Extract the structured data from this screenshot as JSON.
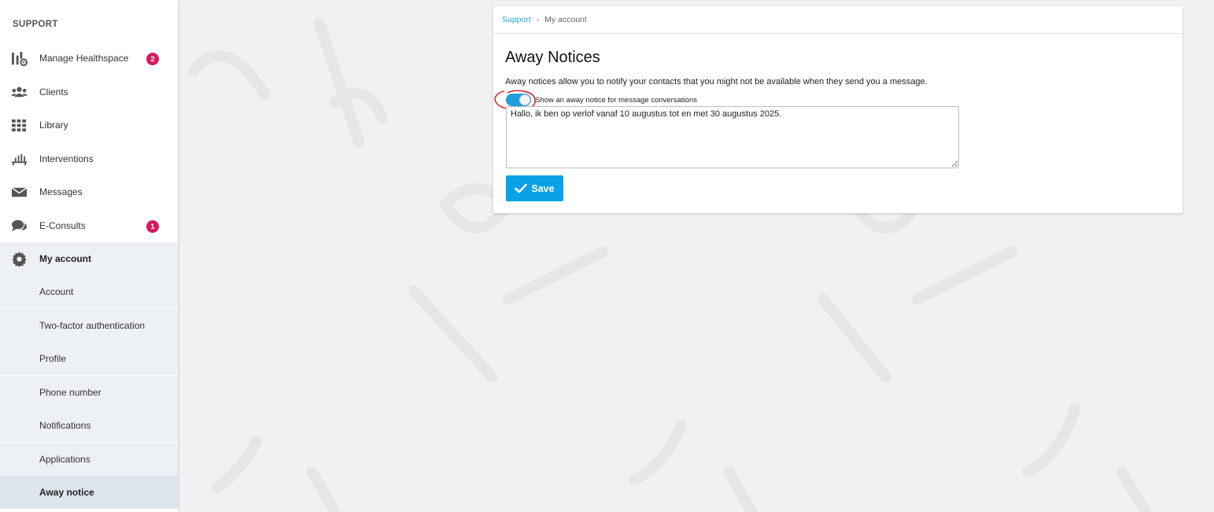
{
  "sidebar": {
    "heading": "SUPPORT",
    "items": [
      {
        "label": "Manage Healthspace",
        "icon": "manage-icon",
        "badge": "2"
      },
      {
        "label": "Clients",
        "icon": "users-icon"
      },
      {
        "label": "Library",
        "icon": "grid-icon"
      },
      {
        "label": "Interventions",
        "icon": "interventions-icon"
      },
      {
        "label": "Messages",
        "icon": "envelope-icon"
      },
      {
        "label": "E-Consults",
        "icon": "chat-icon",
        "badge": "1"
      },
      {
        "label": "My account",
        "icon": "gear-icon"
      }
    ],
    "subitems": [
      {
        "label": "Account"
      },
      {
        "label": "Two-factor authentication"
      },
      {
        "label": "Profile"
      },
      {
        "label": "Phone number"
      },
      {
        "label": "Notifications"
      },
      {
        "label": "Applications"
      },
      {
        "label": "Away notice"
      }
    ]
  },
  "breadcrumb": {
    "root": "Support",
    "separator": "›",
    "current": "My account"
  },
  "main": {
    "title": "Away Notices",
    "description": "Away notices allow you to notify your contacts that you might not be available when they send you a message.",
    "toggle_label": "Show an away notice for message conversations",
    "toggle_on": true,
    "message": "Hallo, ik ben op verlof vanaf 10 augustus tot en met 30 augustus 2025.",
    "save_label": "Save"
  },
  "colors": {
    "accent": "#0aa2e6",
    "badge": "#d31c5b",
    "link": "#27a7cf",
    "annotation": "#d0141b"
  }
}
